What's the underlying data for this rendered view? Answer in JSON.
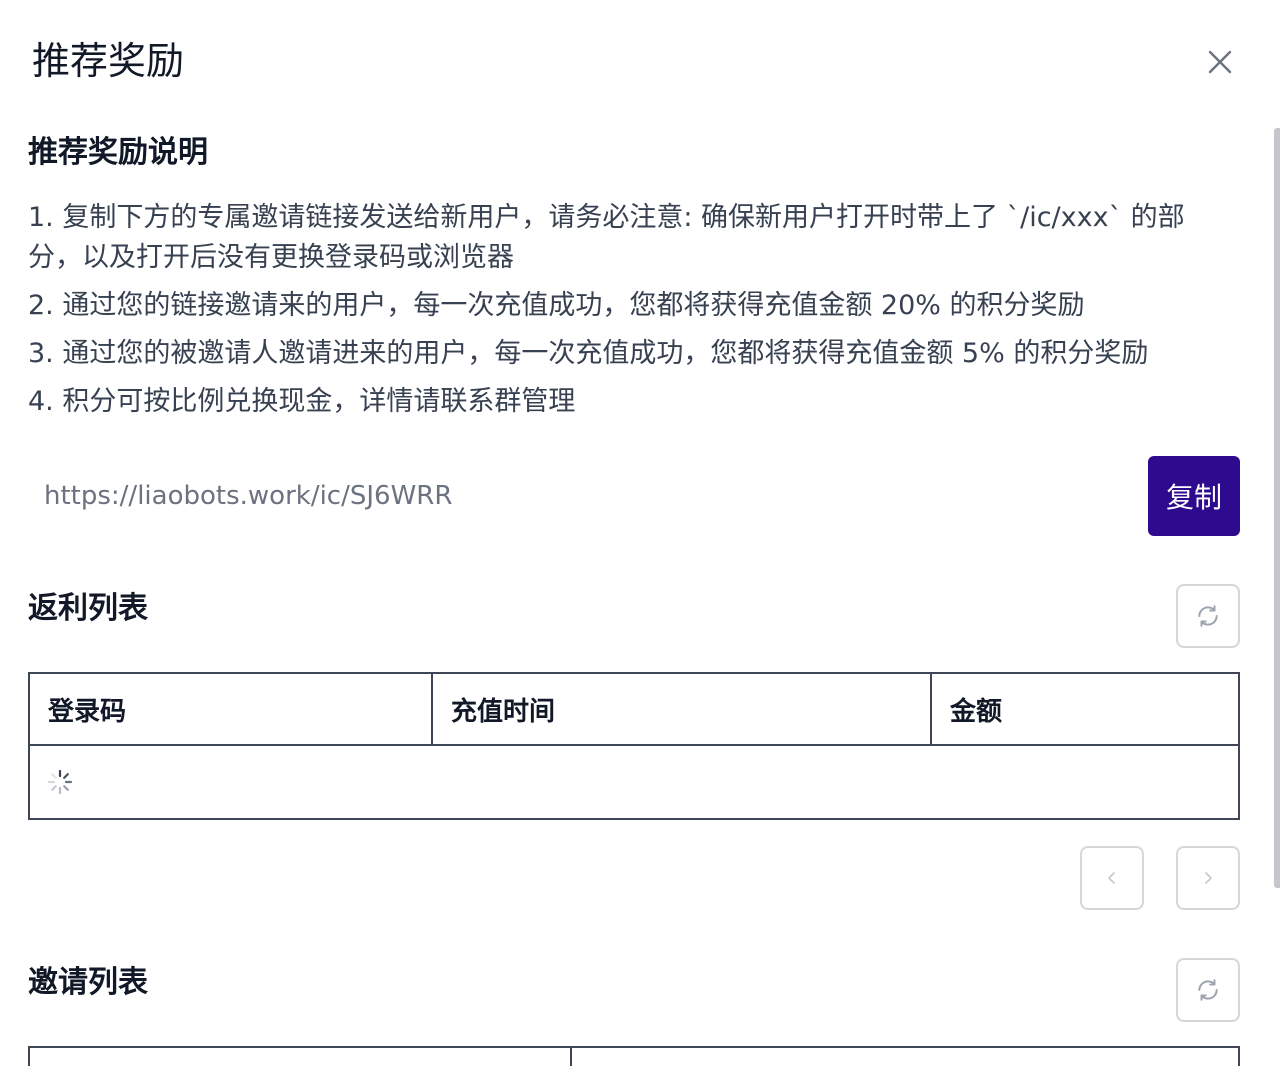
{
  "modal": {
    "title": "推荐奖励",
    "close_icon": "close-icon"
  },
  "rules": {
    "heading": "推荐奖励说明",
    "items": [
      "1. 复制下方的专属邀请链接发送给新用户，请务必注意: 确保新用户打开时带上了 `/ic/xxx` 的部分，以及打开后没有更换登录码或浏览器",
      "2. 通过您的链接邀请来的用户，每一次充值成功，您都将获得充值金额 20% 的积分奖励",
      "3. 通过您的被邀请人邀请进来的用户，每一次充值成功，您都将获得充值金额 5% 的积分奖励",
      "4. 积分可按比例兑换现金，详情请联系群管理"
    ]
  },
  "invite": {
    "link": "https://liaobots.work/ic/SJ6WRR",
    "copy_label": "复制",
    "copy_button_color": "#2e0b8e"
  },
  "rebate": {
    "heading": "返利列表",
    "refresh_icon": "refresh-icon",
    "columns": [
      "登录码",
      "充值时间",
      "金额"
    ],
    "rows": [],
    "loading_icon": "loading-spinner-icon",
    "prev_icon": "chevron-left-icon",
    "next_icon": "chevron-right-icon"
  },
  "invites": {
    "heading": "邀请列表",
    "refresh_icon": "refresh-icon"
  }
}
